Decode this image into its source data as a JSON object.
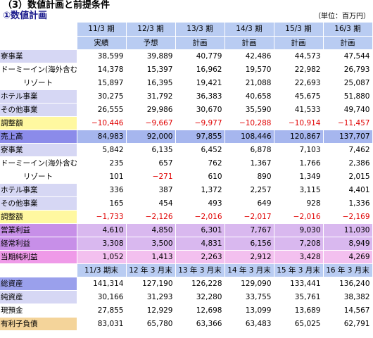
{
  "title": "（3）数値計画と前提条件",
  "subtitle": "①数値計画",
  "unit": "（単位：百万円）",
  "periods": [
    "11/3 期",
    "12/3 期",
    "13/3 期",
    "14/3 期",
    "15/3 期",
    "16/3 期"
  ],
  "period_types": [
    "実績",
    "予想",
    "計画",
    "計画",
    "計画",
    "計画"
  ],
  "sales_rows": [
    {
      "label": "寮事業",
      "values": [
        "38,599",
        "39,889",
        "40,779",
        "42,486",
        "44,573",
        "47,544"
      ],
      "style": "seg",
      "indent": false
    },
    {
      "label": "ドーミーイン(海外含む)",
      "values": [
        "14,378",
        "15,397",
        "16,962",
        "19,570",
        "22,982",
        "26,793"
      ],
      "style": "white",
      "indent": false
    },
    {
      "label": "リゾート",
      "values": [
        "15,897",
        "16,395",
        "19,421",
        "21,088",
        "22,693",
        "25,087"
      ],
      "style": "white",
      "indent": true
    },
    {
      "label": "ホテル事業",
      "values": [
        "30,275",
        "31,792",
        "36,383",
        "40,658",
        "45,675",
        "51,880"
      ],
      "style": "seg",
      "indent": false
    },
    {
      "label": "その他事業",
      "values": [
        "26,555",
        "29,986",
        "30,670",
        "35,590",
        "41,533",
        "49,740"
      ],
      "style": "seg",
      "indent": false
    },
    {
      "label": "調整額",
      "values": [
        "−10,446",
        "−9,667",
        "−9,977",
        "−10,288",
        "−10,914",
        "−11,457"
      ],
      "style": "adj",
      "indent": false
    },
    {
      "label": "売上高",
      "values": [
        "84,983",
        "92,000",
        "97,855",
        "108,446",
        "120,867",
        "137,707"
      ],
      "style": "total",
      "indent": false
    }
  ],
  "profit_rows": [
    {
      "label": "寮事業",
      "values": [
        "5,842",
        "6,135",
        "6,452",
        "6,878",
        "7,103",
        "7,462"
      ],
      "style": "seg",
      "indent": false
    },
    {
      "label": "ドーミーイン(海外含む)",
      "values": [
        "235",
        "657",
        "762",
        "1,367",
        "1,766",
        "2,386"
      ],
      "style": "white",
      "indent": false
    },
    {
      "label": "リゾート",
      "values": [
        "101",
        "−271",
        "610",
        "890",
        "1,349",
        "2,015"
      ],
      "style": "white",
      "indent": true
    },
    {
      "label": "ホテル事業",
      "values": [
        "336",
        "387",
        "1,372",
        "2,257",
        "3,115",
        "4,401"
      ],
      "style": "seg",
      "indent": false
    },
    {
      "label": "その他事業",
      "values": [
        "165",
        "454",
        "493",
        "649",
        "928",
        "1,336"
      ],
      "style": "seg",
      "indent": false
    },
    {
      "label": "調整額",
      "values": [
        "−1,733",
        "−2,126",
        "−2,016",
        "−2,017",
        "−2,016",
        "−2,169"
      ],
      "style": "adj",
      "indent": false
    },
    {
      "label": "営業利益",
      "values": [
        "4,610",
        "4,850",
        "6,301",
        "7,767",
        "9,030",
        "11,030"
      ],
      "style": "profit",
      "indent": false
    },
    {
      "label": "経常利益",
      "values": [
        "3,308",
        "3,500",
        "4,831",
        "6,156",
        "7,208",
        "8,949"
      ],
      "style": "profit",
      "indent": false
    },
    {
      "label": "当期純利益",
      "values": [
        "1,052",
        "1,413",
        "2,263",
        "2,912",
        "3,428",
        "4,269"
      ],
      "style": "net",
      "indent": false
    }
  ],
  "bs_periods": [
    "11/3 期末",
    "12 年 3 月末",
    "13 年 3 月末",
    "14 年 3 月末",
    "15 年 3 月末",
    "16 年 3 月末"
  ],
  "bs_rows": [
    {
      "label": "総資産",
      "values": [
        "141,314",
        "127,190",
        "126,228",
        "129,090",
        "133,441",
        "136,240"
      ],
      "style": "assets"
    },
    {
      "label": "純資産",
      "values": [
        "30,166",
        "31,293",
        "32,280",
        "33,755",
        "35,761",
        "38,382"
      ],
      "style": "bal"
    },
    {
      "label": "現預金",
      "values": [
        "27,855",
        "12,929",
        "12,698",
        "13,099",
        "13,689",
        "14,567"
      ],
      "style": "white"
    },
    {
      "label": "有利子負債",
      "values": [
        "83,031",
        "65,780",
        "63,366",
        "63,483",
        "65,025",
        "62,791"
      ],
      "style": "debt"
    }
  ]
}
